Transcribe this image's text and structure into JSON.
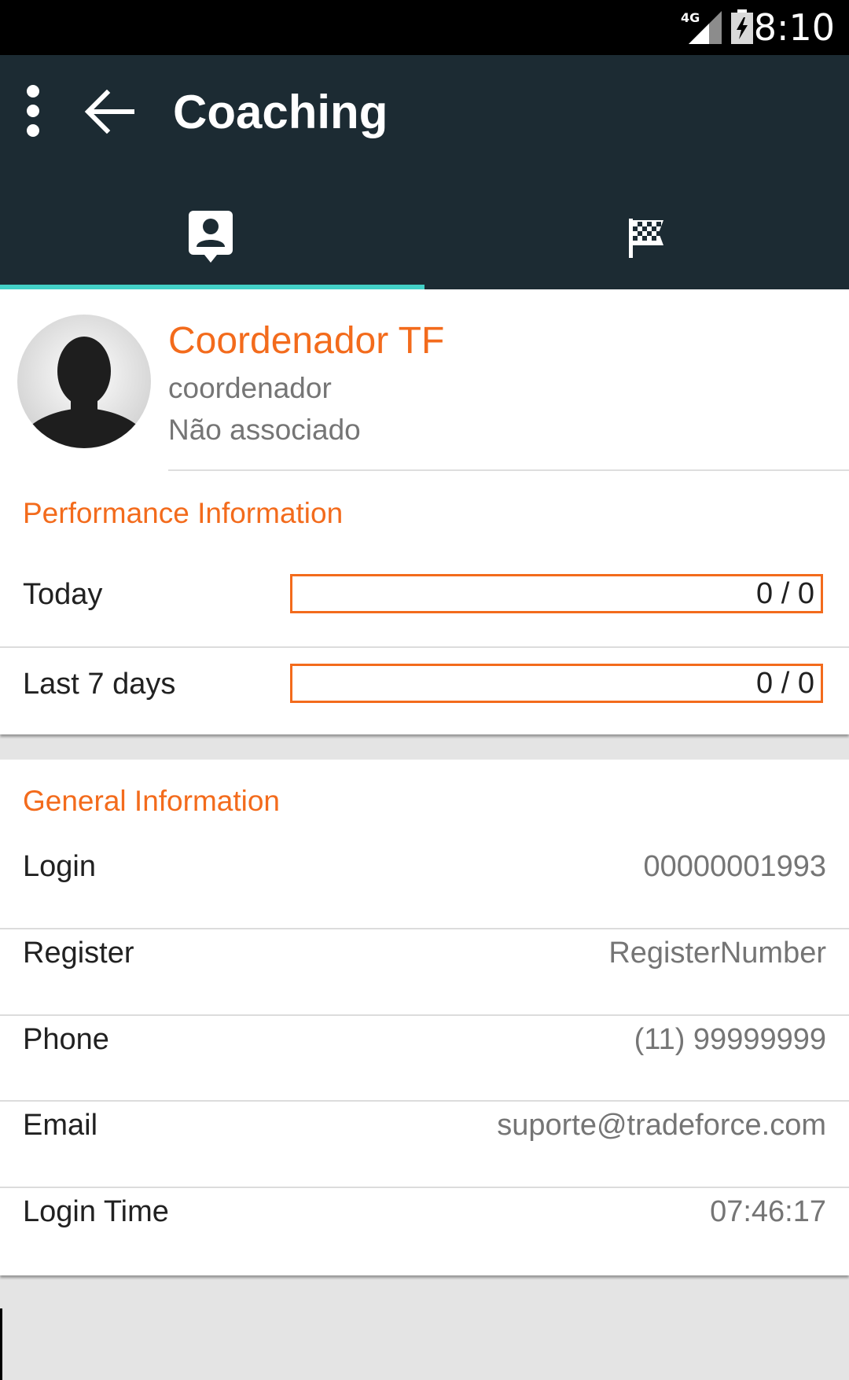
{
  "status_bar": {
    "network": "4G",
    "time": "8:10",
    "icons": [
      "signal-4g-icon",
      "battery-charging-icon"
    ]
  },
  "app_bar": {
    "title": "Coaching",
    "icons": [
      "overflow-menu-icon",
      "back-arrow-icon"
    ],
    "color": "#1c2b33"
  },
  "tabs": [
    {
      "icon": "profile-badge-icon",
      "selected": true
    },
    {
      "icon": "checkered-flag-icon",
      "selected": false
    }
  ],
  "theme": {
    "accent": "#f36b1c",
    "tab_indicator": "#43d0c7"
  },
  "profile": {
    "avatar_icon": "person-silhouette-icon",
    "name": "Coordenador TF",
    "role": "coordenador",
    "status": "Não associado"
  },
  "performance": {
    "title": "Performance Information",
    "rows": [
      {
        "label": "Today",
        "value": "0 / 0",
        "progress": 0
      },
      {
        "label": "Last 7 days",
        "value": "0 / 0",
        "progress": 0
      }
    ]
  },
  "general": {
    "title": "General Information",
    "rows": [
      {
        "label": "Login",
        "value": "00000001993"
      },
      {
        "label": "Register",
        "value": "RegisterNumber"
      },
      {
        "label": "Phone",
        "value": "(11) 99999999"
      },
      {
        "label": "Email",
        "value": "suporte@tradeforce.com"
      },
      {
        "label": "Login Time",
        "value": "07:46:17"
      }
    ]
  }
}
